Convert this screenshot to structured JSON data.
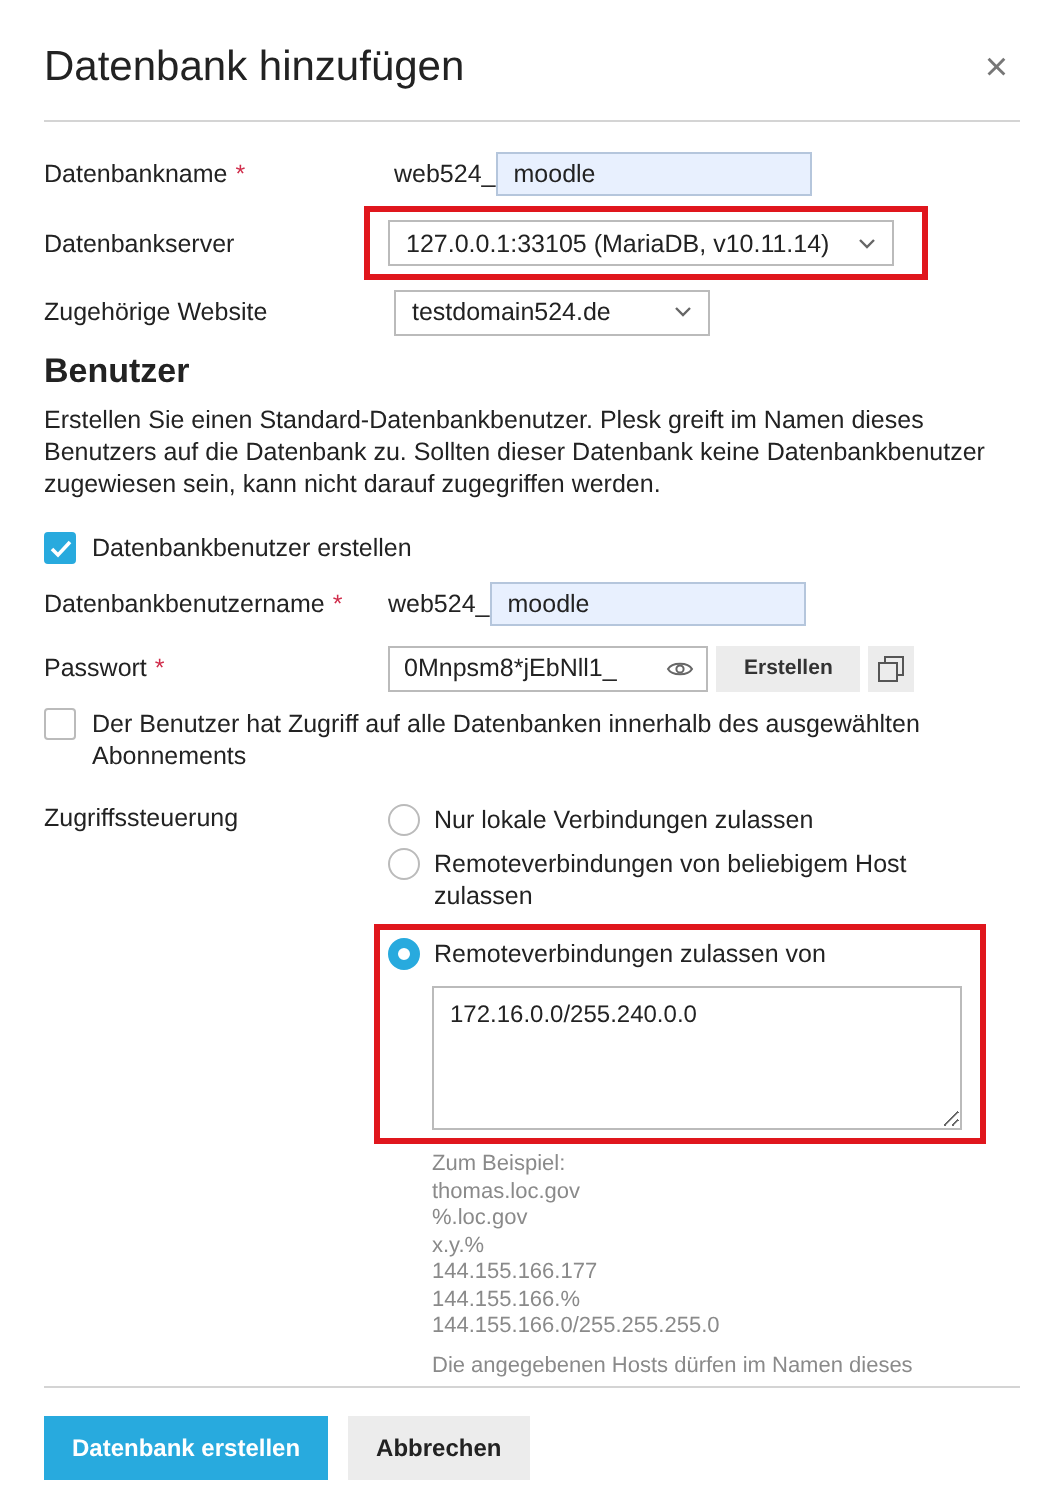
{
  "dialog": {
    "title": "Datenbank hinzufügen",
    "close": "×"
  },
  "fields": [
    {
      "kind": "prefixed",
      "label": "Datenbankname",
      "required_mark": "*",
      "prefix": "web524_",
      "value": "moodle",
      "highlighted": false
    },
    {
      "kind": "select",
      "label": "Datenbankserver",
      "value": "127.0.0.1:33105 (MariaDB, v10.11.14)",
      "highlighted": true
    },
    {
      "kind": "select",
      "label": "Zugehörige Website",
      "value": "testdomain524.de",
      "highlighted": false
    }
  ],
  "user_section": {
    "heading": "Benutzer",
    "description": "Erstellen Sie einen Standard-Datenbankbenutzer. Plesk greift im Namen dieses Benutzers auf die Datenbank zu. Sollten dieser Datenbank keine Datenbankbenutzer zugewiesen sein, kann nicht darauf zugegriffen werden.",
    "create_user": {
      "label": "Datenbankbenutzer erstellen",
      "checked": true
    },
    "username": {
      "label": "Datenbankbenutzername",
      "required_mark": "*",
      "prefix": "web524_",
      "value": "moodle"
    },
    "password": {
      "label": "Passwort",
      "required_mark": "*",
      "value": "0Mnpsm8*jEbNll1_",
      "generate_button": "Erstellen"
    },
    "all_databases": {
      "label": "Der Benutzer hat Zugriff auf alle Datenbanken innerhalb des ausgewählten Abonnements",
      "checked": false
    },
    "access": {
      "label": "Zugriffssteuerung",
      "options": [
        {
          "label": "Nur lokale Verbindungen zulassen",
          "selected": false,
          "highlighted": false
        },
        {
          "label": "Remoteverbindungen von beliebigem Host zulassen",
          "selected": false,
          "highlighted": false
        },
        {
          "label": "Remoteverbindungen zulassen von",
          "selected": true,
          "highlighted": true,
          "value": "172.16.0.0/255.240.0.0"
        }
      ],
      "hint_lines": [
        "Zum Beispiel:",
        "thomas.loc.gov",
        "%.loc.gov",
        "x.y.%",
        "144.155.166.177",
        "144.155.166.%",
        "144.155.166.0/255.255.255.0"
      ],
      "note": "Die angegebenen Hosts dürfen im Namen dieses"
    }
  },
  "buttons": [
    {
      "label": "Datenbank erstellen",
      "kind": "primary"
    },
    {
      "label": "Abbrechen",
      "kind": "secondary"
    }
  ]
}
